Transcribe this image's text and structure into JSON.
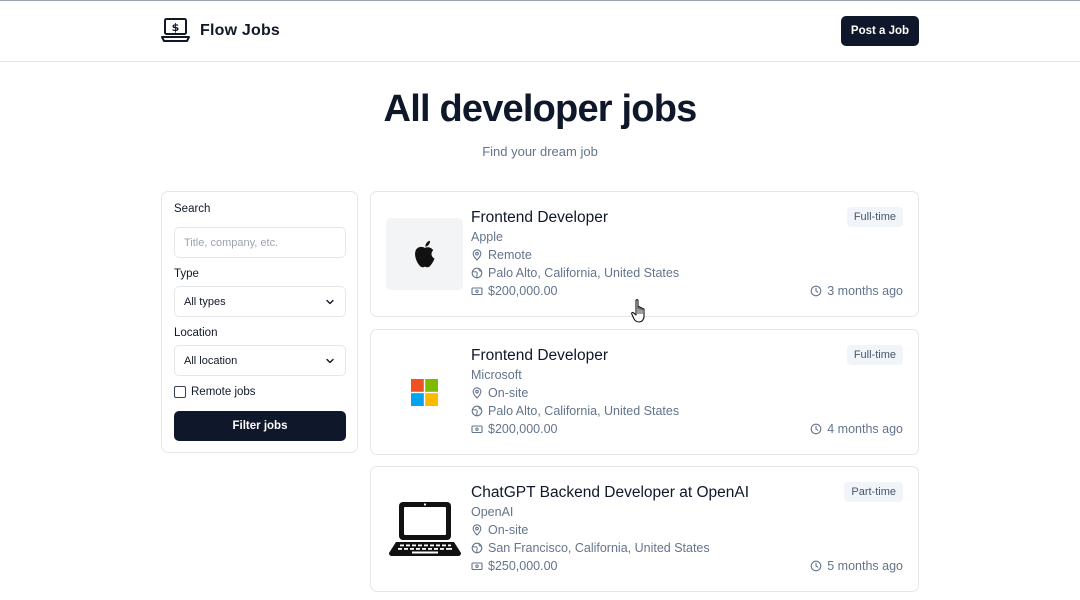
{
  "header": {
    "brand_name": "Flow Jobs",
    "post_job_label": "Post a Job"
  },
  "hero": {
    "title": "All developer jobs",
    "subtitle": "Find your dream job"
  },
  "filters": {
    "search_label": "Search",
    "search_placeholder": "Title, company, etc.",
    "search_value": "",
    "type_label": "Type",
    "type_selected": "All types",
    "location_label": "Location",
    "location_selected": "All location",
    "remote_label": "Remote jobs",
    "remote_checked": false,
    "filter_button_label": "Filter jobs"
  },
  "jobs": [
    {
      "title": "Frontend Developer",
      "company": "Apple",
      "work_mode": "Remote",
      "location": "Palo Alto, California, United States",
      "salary": "$200,000.00",
      "type": "Full-time",
      "posted": "3 months ago",
      "logo_icon": "apple-logo-icon"
    },
    {
      "title": "Frontend Developer",
      "company": "Microsoft",
      "work_mode": "On-site",
      "location": "Palo Alto, California, United States",
      "salary": "$200,000.00",
      "type": "Full-time",
      "posted": "4 months ago",
      "logo_icon": "microsoft-logo-icon"
    },
    {
      "title": "ChatGPT Backend Developer at OpenAI",
      "company": "OpenAI",
      "work_mode": "On-site",
      "location": "San Francisco, California, United States",
      "salary": "$250,000.00",
      "type": "Part-time",
      "posted": "5 months ago",
      "logo_icon": "laptop-icon"
    }
  ],
  "colors": {
    "primary": "#0f172a",
    "muted_text": "#64748b",
    "border": "#e5e7eb",
    "badge_bg": "#f1f5f9",
    "microsoft_red": "#f25022",
    "microsoft_green": "#7fba00",
    "microsoft_blue": "#00a4ef",
    "microsoft_yellow": "#ffb900"
  }
}
